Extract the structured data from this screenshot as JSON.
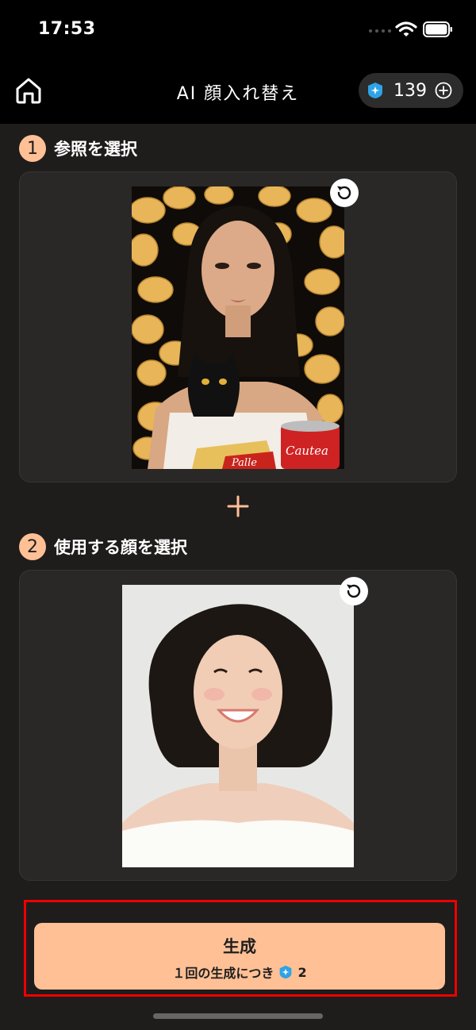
{
  "status_bar": {
    "time": "17:53"
  },
  "header": {
    "title": "AI 顔入れ替え",
    "credits": "139"
  },
  "steps": [
    {
      "number": "1",
      "label": "参照を選択"
    },
    {
      "number": "2",
      "label": "使用する顔を選択"
    }
  ],
  "reference_image": {
    "can_text_1": "Cautea",
    "can_text_2": "Palle"
  },
  "generate": {
    "label": "生成",
    "cost_text": "１回の生成につき",
    "cost": "2"
  },
  "colors": {
    "accent": "#ffc096",
    "background": "#1f1c1c",
    "card": "#2a2727",
    "highlight_border": "#e00000"
  }
}
